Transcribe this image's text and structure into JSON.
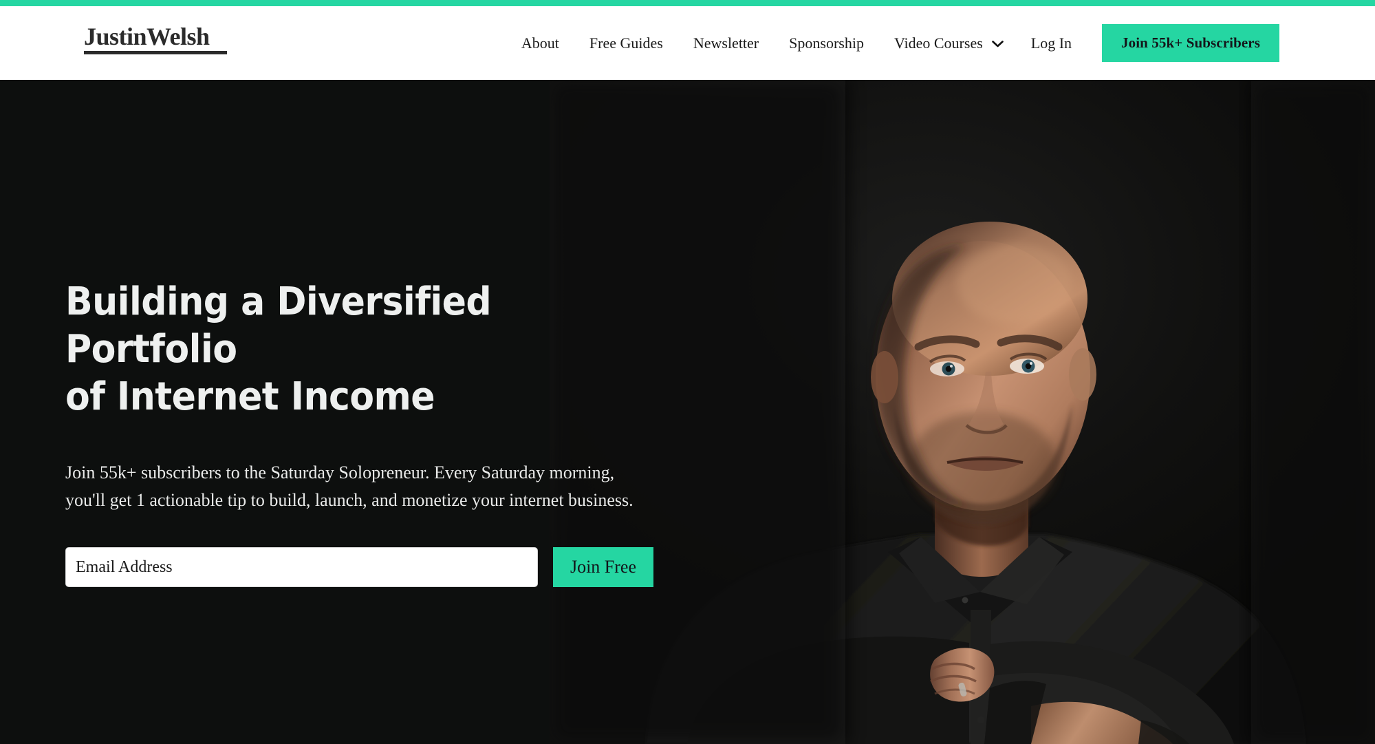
{
  "theme": {
    "accent_green": "#25d6a2",
    "hero_background": "#0d0f0e",
    "header_background": "#ffffff",
    "logo_color": "#2b2b2b",
    "hero_text_color": "#eef0ef"
  },
  "header": {
    "logo": {
      "text": "JustinWelsh",
      "name": "Justin Welsh"
    },
    "nav_items": [
      {
        "label": "About",
        "has_dropdown": false
      },
      {
        "label": "Free Guides",
        "has_dropdown": false
      },
      {
        "label": "Newsletter",
        "has_dropdown": false
      },
      {
        "label": "Sponsorship",
        "has_dropdown": false
      },
      {
        "label": "Video Courses",
        "has_dropdown": true
      },
      {
        "label": "Log In",
        "has_dropdown": false
      }
    ],
    "cta_label": "Join 55k+ Subscribers",
    "dropdown_icon": "chevron-down-icon"
  },
  "hero": {
    "title_line_1": "Building a Diversified Portfolio",
    "title_line_2": "of Internet Income",
    "subtitle": "Join 55k+ subscribers to the Saturday Solopreneur. Every Saturday morning, you'll get 1 actionable tip to build, launch, and monetize your internet business.",
    "form": {
      "email_placeholder": "Email Address",
      "email_value": "",
      "submit_label": "Join Free"
    },
    "photo_alt": "Portrait of Justin Welsh with arms crossed on a dark background"
  }
}
